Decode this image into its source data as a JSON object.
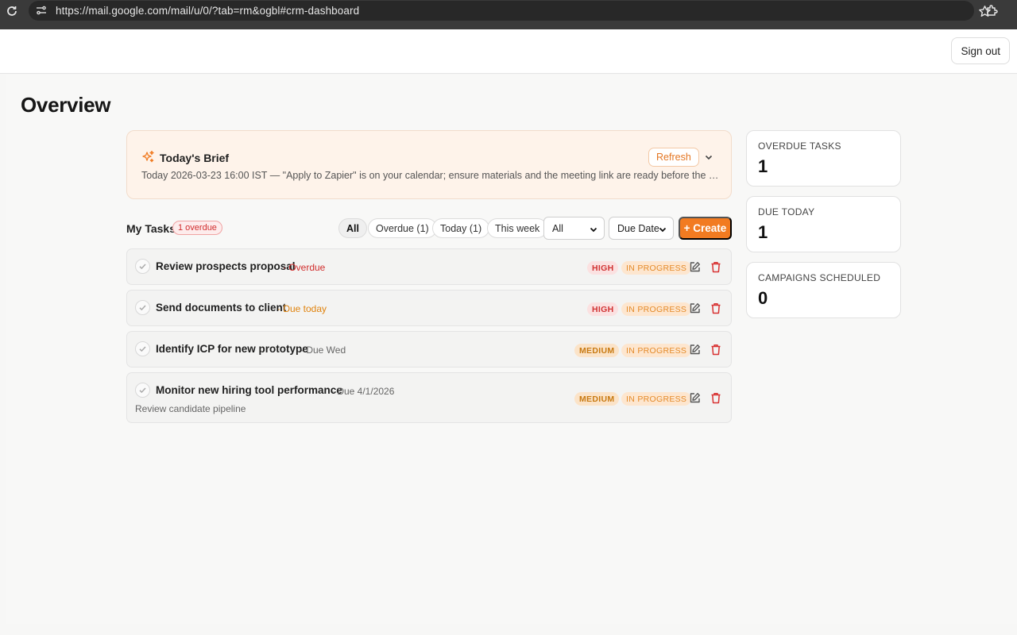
{
  "browser": {
    "url": "https://mail.google.com/mail/u/0/?tab=rm&ogbl#crm-dashboard"
  },
  "header": {
    "signout_label": "Sign out"
  },
  "page": {
    "title": "Overview"
  },
  "brief": {
    "title": "Today's Brief",
    "text": "Today 2026-03-23 16:00 IST — \"Apply to Zapier\" is on your calendar; ensure materials and the meeting link are ready before the 16:00 start. T...",
    "refresh_label": "Refresh"
  },
  "tasks": {
    "label": "My Tasks",
    "overdue_badge": "1 overdue",
    "filters": [
      "All",
      "Overdue (1)",
      "Today (1)",
      "This week"
    ],
    "active_filter": "All",
    "priority_select": "All",
    "sort_select": "Due Date",
    "create_label": "+ Create",
    "items": [
      {
        "title": "Review prospects proposal",
        "due": "· Overdue",
        "priority": "HIGH",
        "status": "IN PROGRESS",
        "description": ""
      },
      {
        "title": "Send documents to client",
        "due": "· Due today",
        "priority": "HIGH",
        "status": "IN PROGRESS",
        "description": ""
      },
      {
        "title": "Identify ICP for new prototype",
        "due": "· Due Wed",
        "priority": "MEDIUM",
        "status": "IN PROGRESS",
        "description": ""
      },
      {
        "title": "Monitor new hiring tool performance",
        "due": "· Due 4/1/2026",
        "priority": "MEDIUM",
        "status": "IN PROGRESS",
        "description": "Review candidate pipeline"
      }
    ]
  },
  "stats": [
    {
      "label": "OVERDUE TASKS",
      "value": "1"
    },
    {
      "label": "DUE TODAY",
      "value": "1"
    },
    {
      "label": "CAMPAIGNS SCHEDULED",
      "value": "0"
    }
  ],
  "colors": {
    "accent": "#f27b21",
    "overdue": "#d12d2d",
    "due_today": "#e0830e"
  },
  "icons": [
    "reload-icon",
    "site-settings-icon",
    "star-icon",
    "extensions-icon",
    "sparkle-icon",
    "chevron-down-icon",
    "check-icon",
    "edit-icon",
    "trash-icon"
  ]
}
